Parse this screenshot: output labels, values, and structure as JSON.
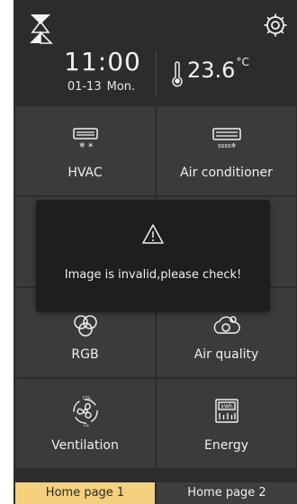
{
  "header": {
    "time": "11:00",
    "date": "01-13",
    "weekday": "Mon.",
    "temperature": "23.6",
    "temperature_unit": "°C",
    "logo_icon": "brand-logo-icon",
    "settings_icon": "gear-icon",
    "thermometer_icon": "thermometer-icon"
  },
  "tiles": [
    {
      "label": "HVAC",
      "icon": "hvac-unit-icon"
    },
    {
      "label": "Air conditioner",
      "icon": "air-conditioner-icon"
    },
    {
      "label": "",
      "icon": ""
    },
    {
      "label": "",
      "icon": ""
    },
    {
      "label": "RGB",
      "icon": "rgb-circles-icon"
    },
    {
      "label": "Air quality",
      "icon": "air-quality-icon"
    },
    {
      "label": "Ventilation",
      "icon": "ventilation-fan-icon"
    },
    {
      "label": "Energy",
      "icon": "energy-meter-icon"
    }
  ],
  "dialog": {
    "icon": "warning-icon",
    "message": "Image is invalid,please check!"
  },
  "tabs": [
    {
      "label": "Home page 1",
      "active": true
    },
    {
      "label": "Home page 2",
      "active": false
    }
  ],
  "colors": {
    "background": "#2c2c2c",
    "tile": "#3b3b3b",
    "dialog": "#1e1e1e",
    "active_tab": "#f4cf7e",
    "text": "#efefef"
  }
}
